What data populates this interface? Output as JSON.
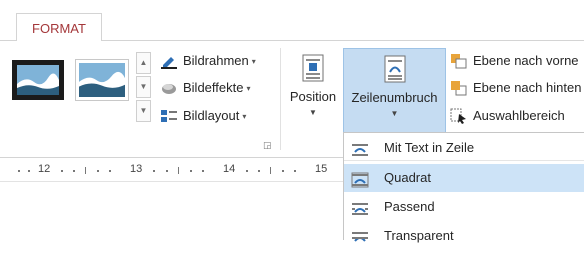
{
  "tabs": {
    "format": "FORMAT"
  },
  "picture_styles": {
    "more_styles_label": "",
    "thumbnail_count": 2
  },
  "picture_commands": {
    "border": "Bildrahmen",
    "effects": "Bildeffekte",
    "layout": "Bildlayout"
  },
  "arrange": {
    "position": "Position",
    "wrap_text": "Zeilenumbruch",
    "bring_forward": "Ebene nach vorne",
    "send_backward": "Ebene nach hinten",
    "selection_pane": "Auswahlbereich"
  },
  "ruler": {
    "numbers": [
      "12",
      "13",
      "14",
      "15"
    ]
  },
  "wrap_menu": {
    "items": [
      {
        "label": "Mit Text in Zeile",
        "selected": false
      },
      {
        "label": "Quadrat",
        "selected": true
      },
      {
        "label": "Passend",
        "selected": false
      },
      {
        "label": "Transparent",
        "selected": false
      }
    ]
  },
  "colors": {
    "tab_accent": "#a4373a",
    "active_button": "#c5dcf2",
    "selected_item": "#cde3f7",
    "icon_blue": "#2e6fb5"
  }
}
